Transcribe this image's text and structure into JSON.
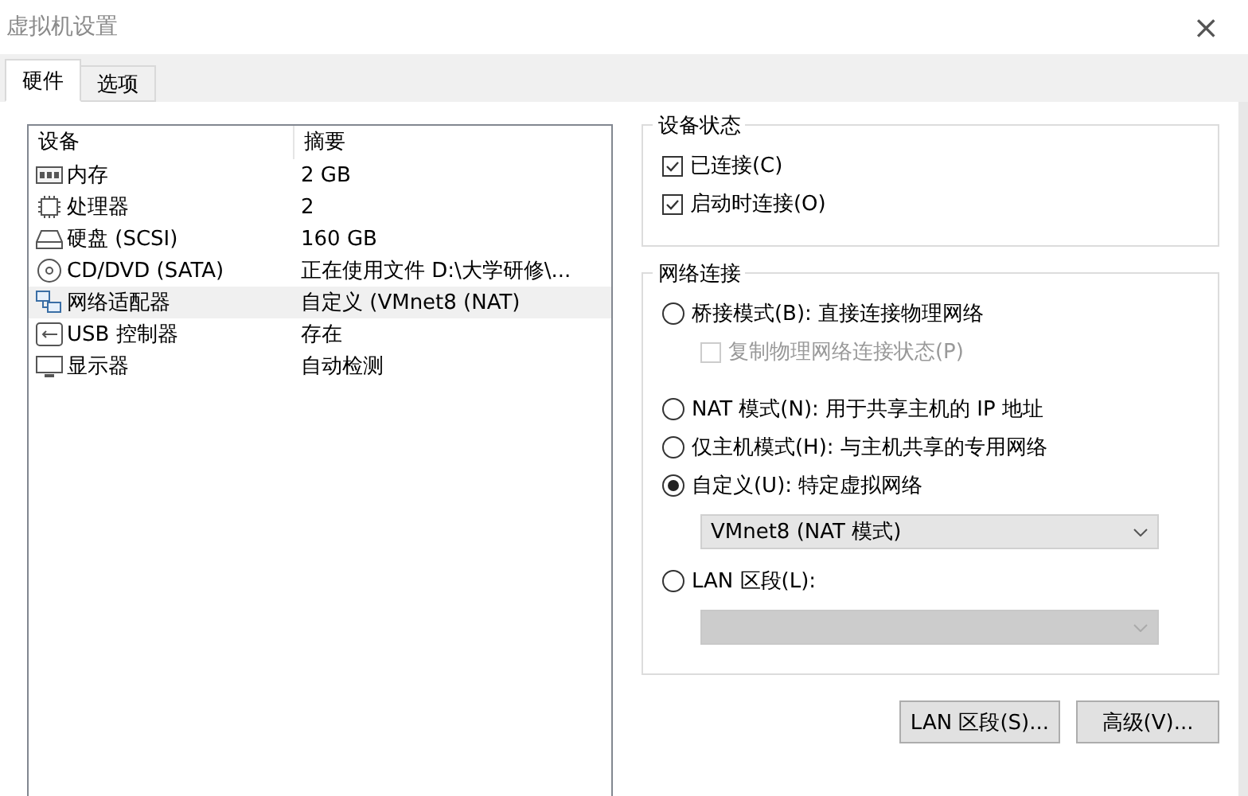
{
  "window": {
    "title": "虚拟机设置",
    "close": "×"
  },
  "tabs": [
    {
      "label": "硬件",
      "selected": true
    },
    {
      "label": "选项",
      "selected": false
    }
  ],
  "devices": {
    "columns": [
      "设备",
      "摘要"
    ],
    "rows": [
      {
        "kind": "memory",
        "name": "内存",
        "summary": "2 GB",
        "selected": false
      },
      {
        "kind": "cpu",
        "name": "处理器",
        "summary": "2",
        "selected": false
      },
      {
        "kind": "disk",
        "name": "硬盘 (SCSI)",
        "summary": "160 GB",
        "selected": false
      },
      {
        "kind": "cd",
        "name": "CD/DVD (SATA)",
        "summary": "正在使用文件 D:\\大学研修\\...",
        "selected": false
      },
      {
        "kind": "network",
        "name": "网络适配器",
        "summary": "自定义 (VMnet8 (NAT)",
        "selected": true
      },
      {
        "kind": "usb",
        "name": "USB 控制器",
        "summary": "存在",
        "selected": false
      },
      {
        "kind": "display",
        "name": "显示器",
        "summary": "自动检测",
        "selected": false
      }
    ]
  },
  "device_status": {
    "title": "设备状态",
    "options": [
      {
        "label": "已连接(C)",
        "checked": true
      },
      {
        "label": "启动时连接(O)",
        "checked": true
      }
    ]
  },
  "network": {
    "title": "网络连接",
    "items": [
      {
        "kind": "radio",
        "label": "桥接模式(B): 直接连接物理网络",
        "selected": false
      },
      {
        "kind": "checkbox",
        "label": "复制物理网络连接状态(P)",
        "checked": false,
        "disabled": true
      },
      {
        "kind": "radio",
        "label": "NAT 模式(N): 用于共享主机的 IP 地址",
        "selected": false
      },
      {
        "kind": "radio",
        "label": "仅主机模式(H): 与主机共享的专用网络",
        "selected": false
      },
      {
        "kind": "radio",
        "label": "自定义(U): 特定虚拟网络",
        "selected": true
      },
      {
        "kind": "dropdown",
        "value": "VMnet8 (NAT 模式)",
        "disabled": false
      },
      {
        "kind": "radio",
        "label": "LAN 区段(L):",
        "selected": false
      },
      {
        "kind": "dropdown",
        "disabled": true
      }
    ]
  },
  "buttons": [
    "LAN 区段(S)...",
    "高级(V)..."
  ]
}
